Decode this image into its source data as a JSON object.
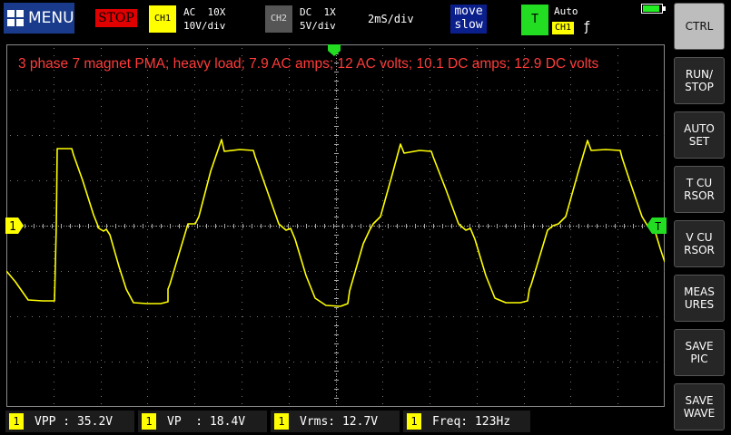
{
  "header": {
    "menu_label": "MENU",
    "run_state": "STOP",
    "ch1": {
      "tag": "CH1",
      "coupling": "AC",
      "probe": "10X",
      "scale": "10V/div"
    },
    "ch2": {
      "tag": "CH2",
      "coupling": "DC",
      "probe": "1X",
      "scale": "5V/div"
    },
    "timebase": "2mS/div",
    "move": {
      "line1": "move",
      "line2": "slow"
    },
    "trigger": {
      "tag": "T",
      "mode": "Auto",
      "source": "CH1",
      "edge": "ƒ"
    },
    "colors": {
      "ch1": "#ffff00",
      "trigger": "#22dd22",
      "stop": "#e00000",
      "title": "#ff3b3b"
    }
  },
  "screen": {
    "annotation": "3 phase 7 magnet PMA; heavy load; 7.9 AC amps; 12 AC volts; 10.1 DC amps; 12.9 DC volts",
    "ch1_marker": "1",
    "trigger_marker": "T"
  },
  "sidebar": {
    "buttons": [
      {
        "label": "CTRL"
      },
      {
        "label": "RUN/\nSTOP"
      },
      {
        "label": "AUTO\nSET"
      },
      {
        "label": "T CU\nRSOR"
      },
      {
        "label": "V CU\nRSOR"
      },
      {
        "label": "MEAS\nURES"
      },
      {
        "label": "SAVE\nPIC"
      },
      {
        "label": "SAVE\nWAVE"
      }
    ]
  },
  "measurements": [
    {
      "ch": "1",
      "text": "VPP : 35.2V"
    },
    {
      "ch": "1",
      "text": "VP  : 18.4V"
    },
    {
      "ch": "1",
      "text": "Vrms: 12.7V"
    },
    {
      "ch": "1",
      "text": "Freq: 123Hz"
    }
  ]
}
